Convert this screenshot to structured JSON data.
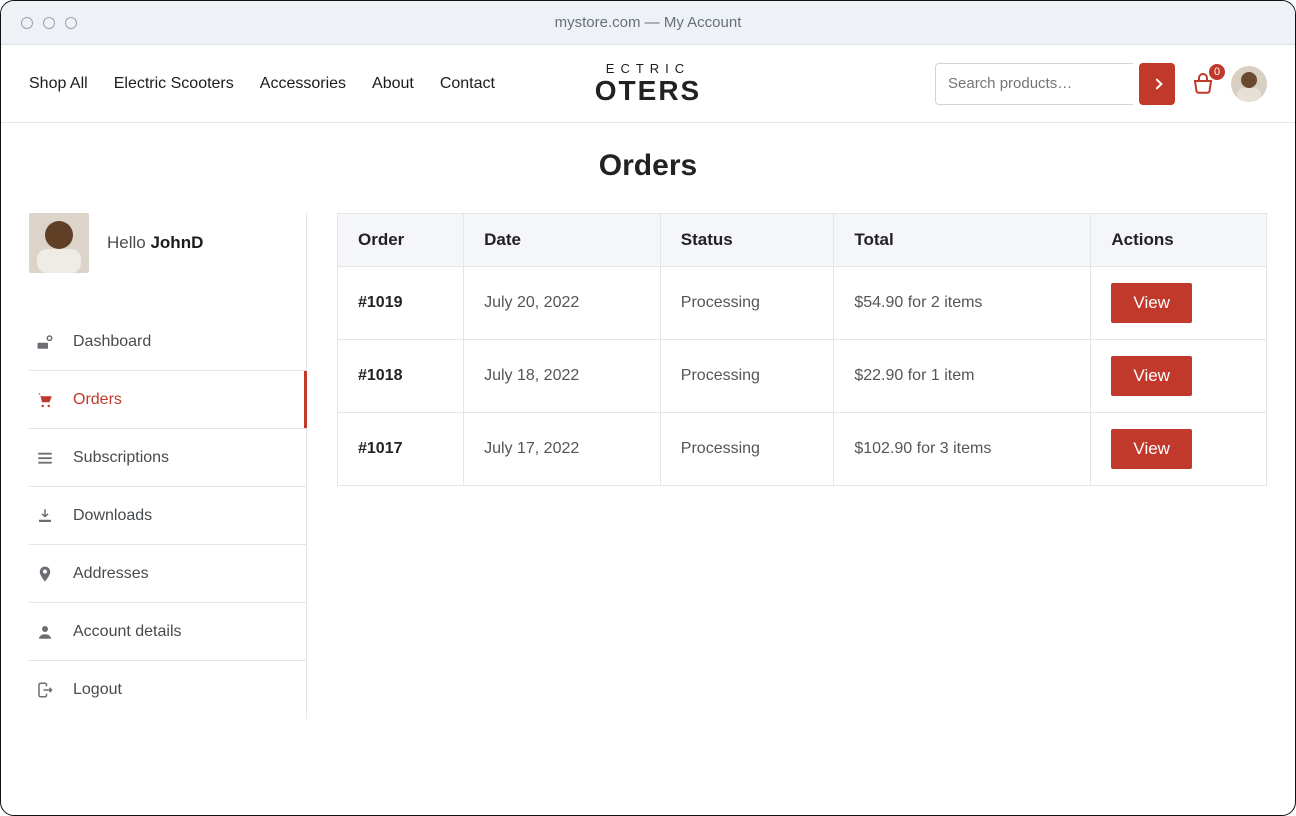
{
  "colors": {
    "accent": "#c0392b"
  },
  "browser": {
    "title": "mystore.com — My Account"
  },
  "nav": {
    "items": [
      "Shop All",
      "Electric Scooters",
      "Accessories",
      "About",
      "Contact"
    ]
  },
  "logo": {
    "top": "ECTRIC",
    "bottom": "OTERS"
  },
  "search": {
    "placeholder": "Search products…"
  },
  "cart": {
    "count": "0"
  },
  "page": {
    "title": "Orders"
  },
  "user": {
    "greeting": "Hello ",
    "name": "JohnD"
  },
  "menu": {
    "items": [
      {
        "label": "Dashboard",
        "icon": "dashboard-icon",
        "active": false
      },
      {
        "label": "Orders",
        "icon": "cart-icon",
        "active": true
      },
      {
        "label": "Subscriptions",
        "icon": "list-icon",
        "active": false
      },
      {
        "label": "Downloads",
        "icon": "download-icon",
        "active": false
      },
      {
        "label": "Addresses",
        "icon": "pin-icon",
        "active": false
      },
      {
        "label": "Account details",
        "icon": "user-icon",
        "active": false
      },
      {
        "label": "Logout",
        "icon": "logout-icon",
        "active": false
      }
    ]
  },
  "table": {
    "headers": [
      "Order",
      "Date",
      "Status",
      "Total",
      "Actions"
    ],
    "rows": [
      {
        "order": "#1019",
        "date": "July 20, 2022",
        "status": "Processing",
        "total": "$54.90 for 2 items",
        "action": "View"
      },
      {
        "order": "#1018",
        "date": "July 18, 2022",
        "status": "Processing",
        "total": "$22.90 for 1 item",
        "action": "View"
      },
      {
        "order": "#1017",
        "date": "July 17, 2022",
        "status": "Processing",
        "total": "$102.90 for 3 items",
        "action": "View"
      }
    ]
  }
}
